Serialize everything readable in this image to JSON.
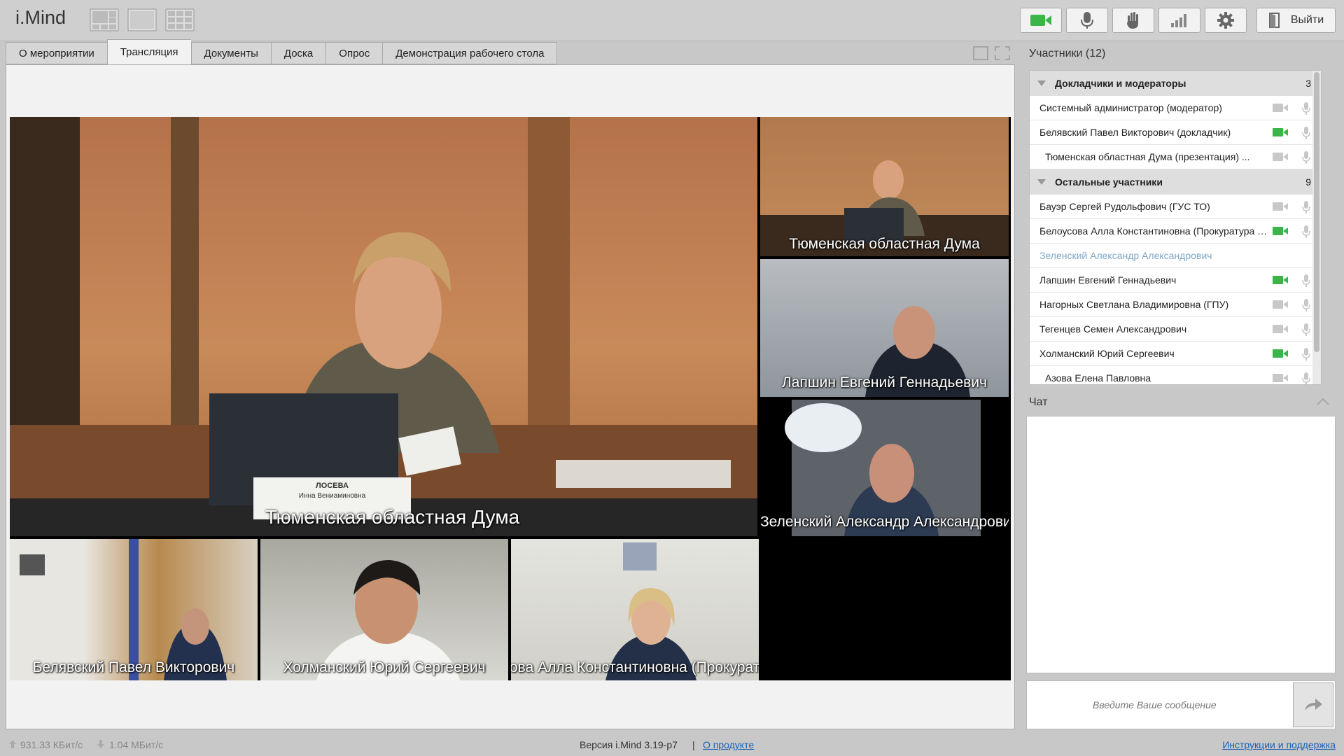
{
  "app": {
    "title": "i.Mind"
  },
  "toolbar": {
    "exit_label": "Выйти"
  },
  "tabs": [
    {
      "label": "О мероприятии"
    },
    {
      "label": "Трансляция"
    },
    {
      "label": "Документы"
    },
    {
      "label": "Доска"
    },
    {
      "label": "Опрос"
    },
    {
      "label": "Демонстрация рабочего стола"
    }
  ],
  "videos": {
    "main": "Тюменская областная Дума",
    "side1": "Тюменская областная Дума",
    "side2": "Лапшин Евгений Геннадьевич",
    "side3": "Зеленский Александр Александрович",
    "bottom1": "Белявский Павел Викторович",
    "bottom2": "Холманский Юрий Сергеевич",
    "bottom3": "ова Алла Константиновна (Прокурату",
    "nameplate_line1": "ЛОСЕВА",
    "nameplate_line2": "Инна Вениаминовна"
  },
  "participants": {
    "title": "Участники (12)",
    "groups": [
      {
        "name": "Докладчики и модераторы",
        "count": "3",
        "members": [
          {
            "name": "Системный администратор (модератор)",
            "cam": "off"
          },
          {
            "name": "Белявский Павел Викторович (докладчик)",
            "cam": "on"
          },
          {
            "name": "Тюменская областная Дума (презентация) ...",
            "cam": "off"
          }
        ]
      },
      {
        "name": "Остальные участники",
        "count": "9",
        "members": [
          {
            "name": "Бауэр Сергей Рудольфович (ГУС ТО)",
            "cam": "off"
          },
          {
            "name": "Белоусова Алла Константиновна (Прокуратура ТО)",
            "cam": "on"
          },
          {
            "name": "Зеленский Александр Александрович",
            "cam": "none"
          },
          {
            "name": "Лапшин Евгений Геннадьевич",
            "cam": "on"
          },
          {
            "name": "Нагорных Светлана Владимировна (ГПУ)",
            "cam": "off"
          },
          {
            "name": "Тегенцев Семен Александрович",
            "cam": "off"
          },
          {
            "name": "Холманский Юрий Сергеевич",
            "cam": "on"
          },
          {
            "name": "Азова Елена Павловна",
            "cam": "off"
          }
        ]
      }
    ]
  },
  "chat": {
    "title": "Чат",
    "placeholder": "Введите Ваше сообщение"
  },
  "status": {
    "upload": "931.33 КБит/с",
    "download": "1.04 МБит/с",
    "version": "Версия i.Mind 3.19-p7",
    "separator": "|",
    "about_link": "О продукте",
    "help_link": "Инструкции и поддержка"
  },
  "colors": {
    "accent_green": "#39b54a",
    "muted_name": "#7fa8c8"
  }
}
